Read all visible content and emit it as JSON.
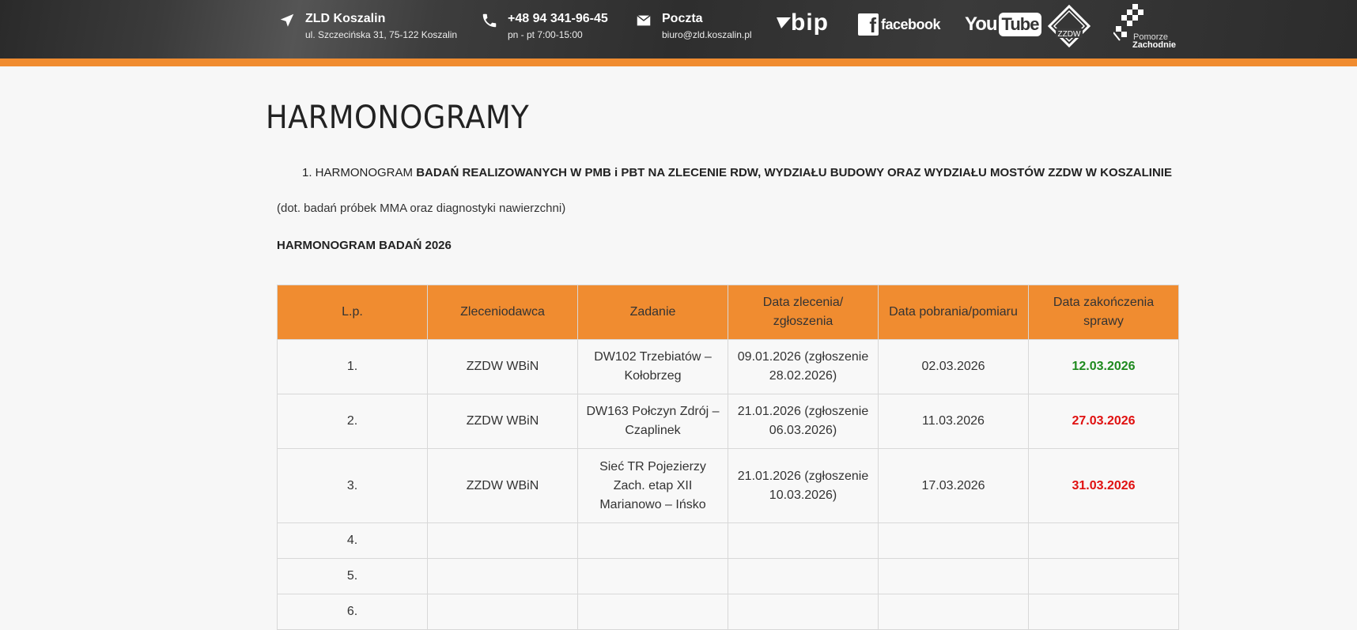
{
  "header": {
    "address": {
      "icon": "location-arrow-icon",
      "title": "ZLD Koszalin",
      "sub": "ul. Szczecińska 31, 75-122 Koszalin"
    },
    "phone": {
      "icon": "phone-icon",
      "title": "+48 94 341-96-45",
      "sub": "pn - pt 7:00-15:00"
    },
    "mail": {
      "icon": "envelope-icon",
      "title": "Poczta",
      "sub": "biuro@zld.koszalin.pl"
    },
    "logos": {
      "bip": "bip",
      "facebook": "facebook",
      "youtube_you": "You",
      "youtube_tube": "Tube",
      "zzdw": "ZZDW",
      "pomorze_1": "Pomorze",
      "pomorze_2": "Zachodnie"
    },
    "accent_color": "#f08c30"
  },
  "page": {
    "title": "HARMONOGRAMY",
    "item_prefix": "1. HARMONOGRAM ",
    "item_bold": "BADAŃ REALIZOWANYCH W PMB i PBT NA ZLECENIE RDW, WYDZIAŁU BUDOWY ORAZ WYDZIAŁU MOSTÓW ZZDW W KOSZALINIE",
    "note": "(dot. badań próbek MMA oraz diagnostyki nawierzchni)",
    "subheading": "HARMONOGRAM BADAŃ 2026"
  },
  "table": {
    "headers": [
      "L.p.",
      "Zleceniodawca",
      "Zadanie",
      "Data zlecenia/ zgłoszenia",
      "Data pobrania/pomiaru",
      "Data zakończenia sprawy"
    ],
    "rows": [
      [
        "1.",
        "ZZDW WBiN",
        "DW102 Trzebiatów – Kołobrzeg",
        "09.01.2026 (zgłoszenie 28.02.2026)",
        "02.03.2026",
        "12.03.2026"
      ],
      [
        "2.",
        "ZZDW WBiN",
        "DW163 Połczyn Zdrój – Czaplinek",
        "21.01.2026 (zgłoszenie 06.03.2026)",
        "11.03.2026",
        "27.03.2026"
      ],
      [
        "3.",
        "ZZDW WBiN",
        "Sieć TR Pojezierzy Zach. etap XII Marianowo – Ińsko",
        "21.01.2026 (zgłoszenie 10.03.2026)",
        "17.03.2026",
        "31.03.2026"
      ],
      [
        "4.",
        "",
        "",
        "",
        "",
        ""
      ],
      [
        "5.",
        "",
        "",
        "",
        "",
        ""
      ],
      [
        "6.",
        "",
        "",
        "",
        "",
        ""
      ]
    ],
    "status_colors": {
      "done": "#1e8a1e",
      "pending": "#e01010"
    }
  }
}
